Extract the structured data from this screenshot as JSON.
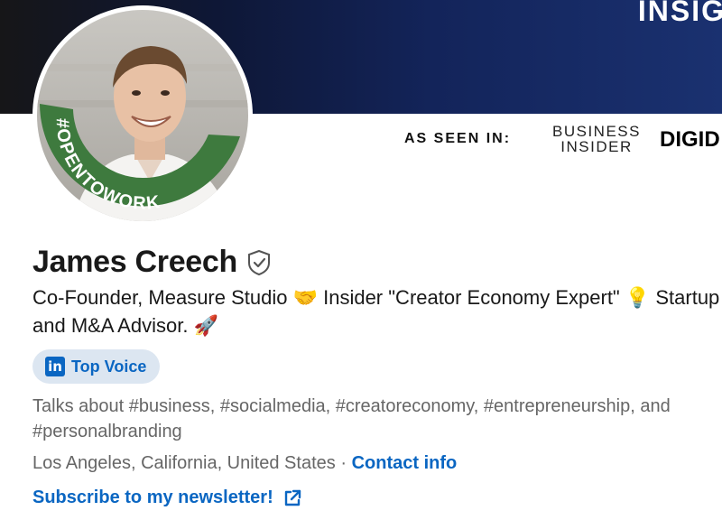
{
  "banner": {
    "headline_fragment": "INSIG",
    "seen_in_label": "AS SEEN IN:",
    "publications": [
      "BUSINESS INSIDER",
      "DIGID"
    ]
  },
  "avatar": {
    "frame_text": "#OPENTOWORK",
    "frame_color": "#3e7a3e"
  },
  "profile": {
    "name": "James Creech",
    "headline": "Co-Founder, Measure Studio 🤝 Insider \"Creator Economy Expert\" 💡 Startup and M&A Advisor. 🚀",
    "badge": {
      "label": "Top Voice",
      "icon": "linkedin-icon"
    },
    "talks_about": "Talks about #business, #socialmedia, #creatoreconomy, #entrepreneurship, and #personalbranding",
    "location": "Los Angeles, California, United States",
    "separator": "·",
    "contact_label": "Contact info",
    "newsletter_label": "Subscribe to my newsletter!"
  },
  "colors": {
    "accent": "#0a66c2",
    "badge_bg": "#dce6f1",
    "muted_text": "#666666",
    "banner_dark": "#13245a"
  }
}
